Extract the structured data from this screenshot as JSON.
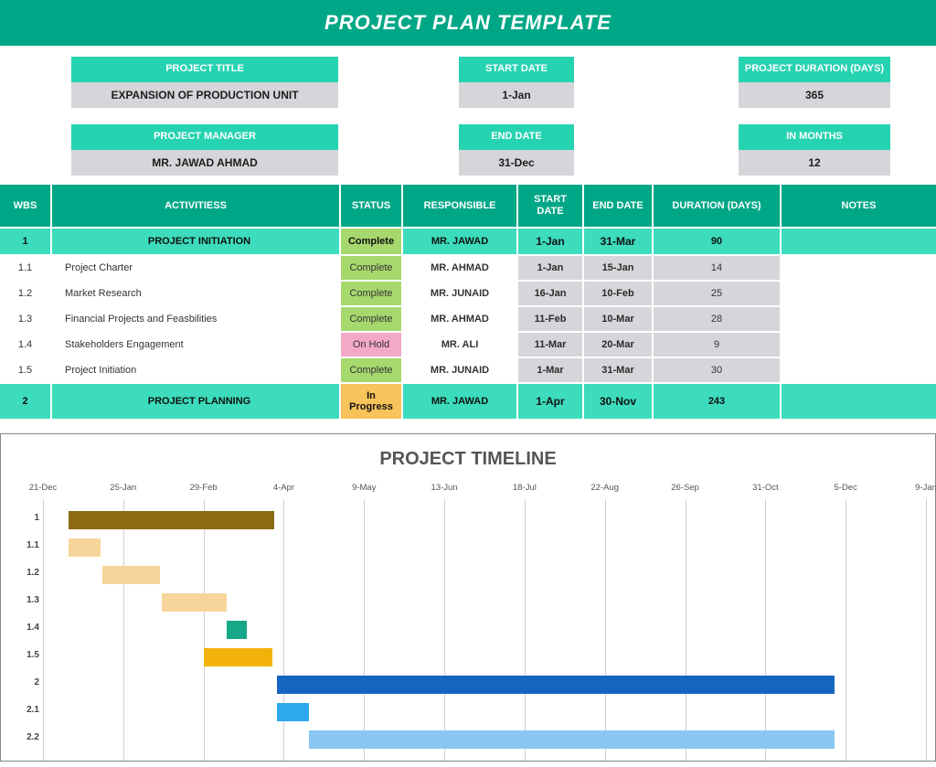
{
  "header": {
    "title": "PROJECT PLAN TEMPLATE"
  },
  "meta": {
    "project_title_label": "PROJECT TITLE",
    "project_title": "EXPANSION OF PRODUCTION UNIT",
    "start_date_label": "START DATE",
    "start_date": "1-Jan",
    "duration_label": "PROJECT DURATION (DAYS)",
    "duration": "365",
    "manager_label": "PROJECT MANAGER",
    "manager": "MR. JAWAD AHMAD",
    "end_date_label": "END DATE",
    "end_date": "31-Dec",
    "months_label": "IN MONTHS",
    "months": "12"
  },
  "table": {
    "headers": {
      "wbs": "WBS",
      "activities": "ACTIVITIESS",
      "status": "STATUS",
      "responsible": "RESPONSIBLE",
      "start": "START DATE",
      "end": "END DATE",
      "duration": "DURATION (DAYS)",
      "notes": "NOTES"
    },
    "rows": [
      {
        "type": "phase",
        "wbs": "1",
        "activity": "PROJECT INITIATION",
        "status": "Complete",
        "status_key": "Complete",
        "responsible": "MR. JAWAD",
        "start": "1-Jan",
        "end": "31-Mar",
        "duration": "90",
        "notes": ""
      },
      {
        "type": "task",
        "wbs": "1.1",
        "activity": "Project Charter",
        "status": "Complete",
        "status_key": "Complete",
        "responsible": "MR. AHMAD",
        "start": "1-Jan",
        "end": "15-Jan",
        "duration": "14",
        "notes": ""
      },
      {
        "type": "task",
        "wbs": "1.2",
        "activity": "Market Research",
        "status": "Complete",
        "status_key": "Complete",
        "responsible": "MR. JUNAID",
        "start": "16-Jan",
        "end": "10-Feb",
        "duration": "25",
        "notes": ""
      },
      {
        "type": "task",
        "wbs": "1.3",
        "activity": "Financial Projects and Feasbilities",
        "status": "Complete",
        "status_key": "Complete",
        "responsible": "MR. AHMAD",
        "start": "11-Feb",
        "end": "10-Mar",
        "duration": "28",
        "notes": ""
      },
      {
        "type": "task",
        "wbs": "1.4",
        "activity": "Stakeholders Engagement",
        "status": "On Hold",
        "status_key": "OnHold",
        "responsible": "MR. ALI",
        "start": "11-Mar",
        "end": "20-Mar",
        "duration": "9",
        "notes": ""
      },
      {
        "type": "task",
        "wbs": "1.5",
        "activity": "Project Initiation",
        "status": "Complete",
        "status_key": "Complete",
        "responsible": "MR. JUNAID",
        "start": "1-Mar",
        "end": "31-Mar",
        "duration": "30",
        "notes": ""
      },
      {
        "type": "phase",
        "wbs": "2",
        "activity": "PROJECT PLANNING",
        "status": "In Progress",
        "status_key": "InProgress",
        "responsible": "MR. JAWAD",
        "start": "1-Apr",
        "end": "30-Nov",
        "duration": "243",
        "notes": ""
      }
    ]
  },
  "chart_data": {
    "type": "gantt",
    "title": "PROJECT TIMELINE",
    "x_ticks": [
      "21-Dec",
      "25-Jan",
      "29-Feb",
      "4-Apr",
      "9-May",
      "13-Jun",
      "18-Jul",
      "22-Aug",
      "26-Sep",
      "31-Oct",
      "5-Dec",
      "9-Jan"
    ],
    "x_range_days": [
      0,
      385
    ],
    "x_tick_days": [
      0,
      35,
      70,
      105,
      140,
      175,
      210,
      245,
      280,
      315,
      350,
      385
    ],
    "rows": [
      {
        "label": "1",
        "start_day": 11,
        "duration": 90,
        "color": "#8a6a12"
      },
      {
        "label": "1.1",
        "start_day": 11,
        "duration": 14,
        "color": "#f7d59a"
      },
      {
        "label": "1.2",
        "start_day": 26,
        "duration": 25,
        "color": "#f7d59a"
      },
      {
        "label": "1.3",
        "start_day": 52,
        "duration": 28,
        "color": "#f7d59a"
      },
      {
        "label": "1.4",
        "start_day": 80,
        "duration": 9,
        "color": "#15a787"
      },
      {
        "label": "1.5",
        "start_day": 70,
        "duration": 30,
        "color": "#f2b20b"
      },
      {
        "label": "2",
        "start_day": 102,
        "duration": 243,
        "color": "#1565c0"
      },
      {
        "label": "2.1",
        "start_day": 102,
        "duration": 14,
        "color": "#2ea8ef"
      },
      {
        "label": "2.2",
        "start_day": 116,
        "duration": 229,
        "color": "#89c6f2"
      }
    ]
  }
}
